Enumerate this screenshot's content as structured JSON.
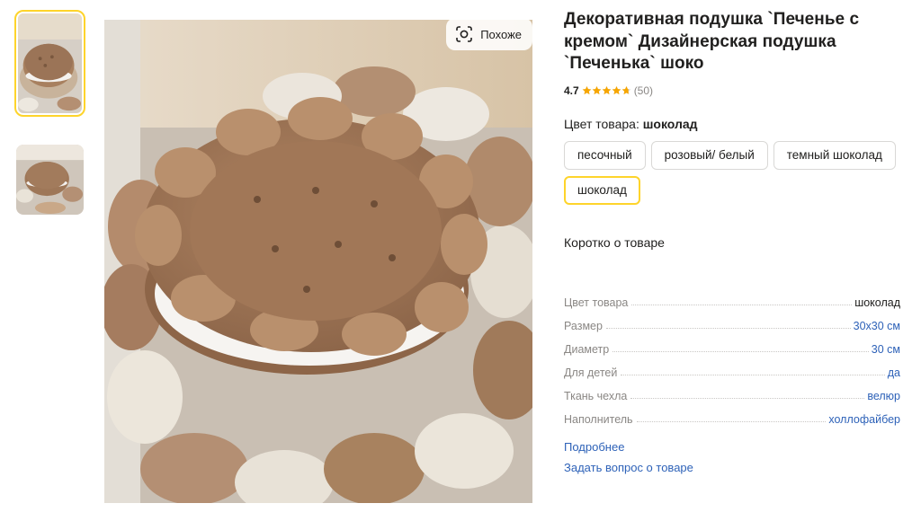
{
  "gallery": {
    "thumbnails": [
      {
        "alt": "thumb-1",
        "active": true
      },
      {
        "alt": "thumb-2",
        "active": false
      }
    ],
    "similar_label": "Похоже"
  },
  "product": {
    "title": "Декоративная подушка `Печенье с кремом` Дизайнерская подушка `Печенька` шоко",
    "rating": "4.7",
    "rating_value": 4.7,
    "rating_max": 5,
    "reviews": "(50)",
    "color_label_prefix": "Цвет товара: ",
    "color_label_value": "шоколад",
    "colors": [
      {
        "label": "песочный",
        "selected": false
      },
      {
        "label": "розовый/ белый",
        "selected": false
      },
      {
        "label": "темный шоколад",
        "selected": false
      },
      {
        "label": "шоколад",
        "selected": true
      }
    ],
    "about_title": "Коротко о товаре",
    "specs": [
      {
        "name": "Цвет товара",
        "value": "шоколад",
        "link": false
      },
      {
        "name": "Размер",
        "value": "30х30 см",
        "link": true
      },
      {
        "name": "Диаметр",
        "value": "30 см",
        "link": true
      },
      {
        "name": "Для детей",
        "value": "да",
        "link": true
      },
      {
        "name": "Ткань чехла",
        "value": "велюр",
        "link": true
      },
      {
        "name": "Наполнитель",
        "value": "холлофайбер",
        "link": true
      }
    ],
    "more_link": "Подробнее",
    "ask_link": "Задать вопрос о товаре"
  },
  "colors": {
    "accent_yellow": "#fed42b",
    "star_orange": "#f7a600",
    "link_blue": "#2e62b8",
    "muted_text": "#8a8784"
  }
}
